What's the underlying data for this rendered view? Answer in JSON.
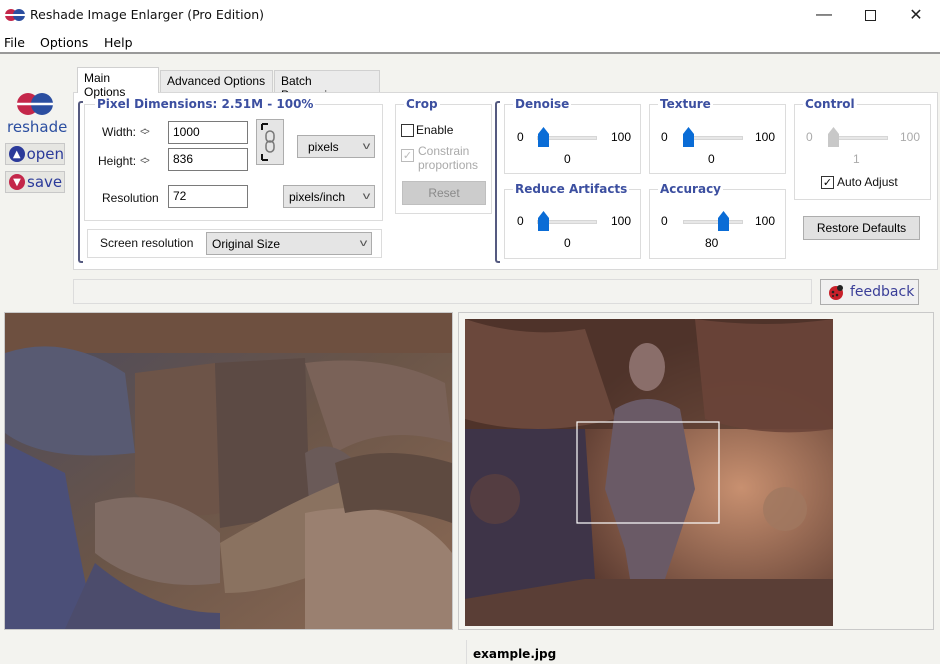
{
  "window": {
    "title": "Reshade Image Enlarger (Pro Edition)",
    "controls": {
      "minimize": "—",
      "maximize": "☐",
      "close": "✕"
    }
  },
  "menu": [
    "File",
    "Options",
    "Help"
  ],
  "brand": {
    "name": "reshade",
    "open_label": "open",
    "save_label": "save",
    "colors": {
      "red": "#c4274a",
      "blue": "#2b4ea0"
    }
  },
  "tabs": [
    {
      "label": "Main Options",
      "active": true
    },
    {
      "label": "Advanced Options",
      "active": false
    },
    {
      "label": "Batch Processing",
      "active": false
    }
  ],
  "pixel_dimensions": {
    "title": "Pixel Dimensions:  2.51M - 100%",
    "width_label": "Width:",
    "height_label": "Height:",
    "link_glyph": "<>",
    "width_value": "1000",
    "height_value": "836",
    "unit": "pixels",
    "resolution_label": "Resolution",
    "resolution_value": "72",
    "resolution_unit": "pixels/inch",
    "constrain_linked": true
  },
  "screen_resolution": {
    "label": "Screen resolution",
    "value": "Original Size"
  },
  "crop": {
    "title": "Crop",
    "enable_label": "Enable",
    "enable_checked": false,
    "constrain_label_1": "Constrain",
    "constrain_label_2": "proportions",
    "constrain_checked": true,
    "constrain_disabled": true,
    "reset_label": "Reset"
  },
  "sliders": {
    "denoise": {
      "title": "Denoise",
      "min": "0",
      "max": "100",
      "value": "0"
    },
    "reduce_artifacts": {
      "title": "Reduce Artifacts",
      "min": "0",
      "max": "100",
      "value": "0"
    },
    "texture": {
      "title": "Texture",
      "min": "0",
      "max": "100",
      "value": "0"
    },
    "accuracy": {
      "title": "Accuracy",
      "min": "0",
      "max": "100",
      "value": "80"
    },
    "control": {
      "title": "Control",
      "min": "0",
      "max": "100",
      "value": "1",
      "disabled": true
    }
  },
  "auto_adjust": {
    "label": "Auto Adjust",
    "checked": true
  },
  "restore_defaults_label": "Restore Defaults",
  "feedback_label": "feedback",
  "preview": {
    "filename": "example.jpg",
    "left_description": "zoomed detail of stone carving",
    "right_description": "full image of dancing figure relief with selection rectangle"
  },
  "check_glyph": "✓",
  "chevron_glyph": "v"
}
